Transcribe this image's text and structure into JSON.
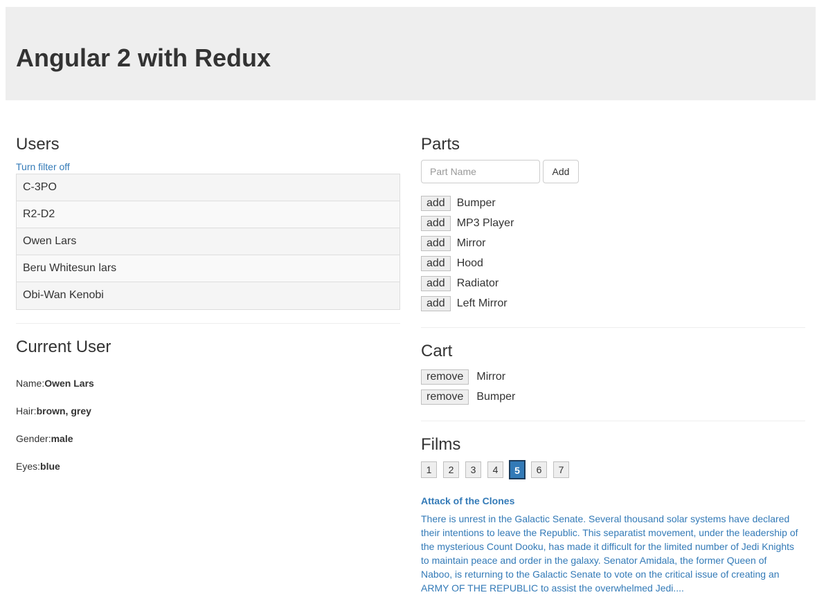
{
  "header": {
    "title": "Angular 2 with Redux"
  },
  "users": {
    "heading": "Users",
    "filter_link": "Turn filter off",
    "items": [
      "C-3PO",
      "R2-D2",
      "Owen Lars",
      "Beru Whitesun lars",
      "Obi-Wan Kenobi"
    ]
  },
  "current_user": {
    "heading": "Current User",
    "fields": [
      {
        "label": "Name:",
        "value": "Owen Lars"
      },
      {
        "label": "Hair:",
        "value": "brown, grey"
      },
      {
        "label": "Gender:",
        "value": "male"
      },
      {
        "label": "Eyes:",
        "value": "blue"
      }
    ]
  },
  "parts": {
    "heading": "Parts",
    "input_placeholder": "Part Name",
    "add_button": "Add",
    "add_label": "add",
    "items": [
      "Bumper",
      "MP3 Player",
      "Mirror",
      "Hood",
      "Radiator",
      "Left Mirror"
    ]
  },
  "cart": {
    "heading": "Cart",
    "remove_label": "remove",
    "items": [
      "Mirror",
      "Bumper"
    ]
  },
  "films": {
    "heading": "Films",
    "pages": [
      "1",
      "2",
      "3",
      "4",
      "5",
      "6",
      "7"
    ],
    "selected": "5",
    "title": "Attack of the Clones",
    "crawl": "There is unrest in the Galactic Senate. Several thousand solar systems have declared\ntheir intentions to leave the Republic.  This separatist movement, under the leadership of\nthe mysterious Count Dooku, has made it difficult for the limited number of Jedi Knights\nto maintain  peace and order in the galaxy.  Senator Amidala, the former Queen of\nNaboo, is returning to the Galactic Senate to vote on the critical issue of creating an\nARMY OF THE REPUBLIC to assist the overwhelmed Jedi...."
  },
  "colors": {
    "link": "#337ab7",
    "jumbotron_bg": "#eeeeee",
    "active_page": "#337ab7"
  }
}
